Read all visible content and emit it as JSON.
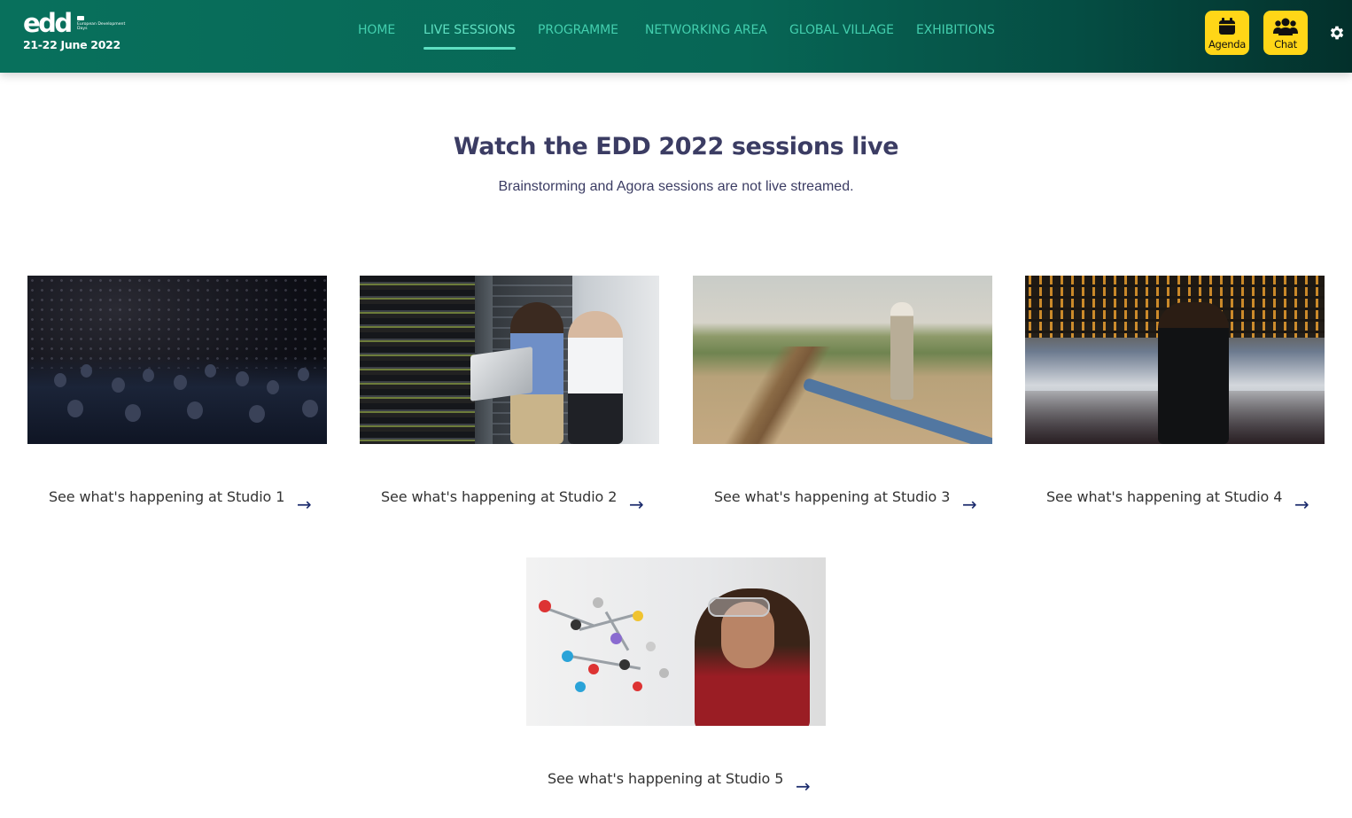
{
  "header": {
    "logo": {
      "wordmark": "edd",
      "subtitle": "European Development Days",
      "dates": "21-22 June 2022"
    },
    "nav": [
      {
        "label": "HOME",
        "active": false
      },
      {
        "label": "LIVE SESSIONS",
        "active": true
      },
      {
        "label": "PROGRAMME",
        "active": false
      },
      {
        "label": "NETWORKING AREA",
        "active": false
      },
      {
        "label": "GLOBAL VILLAGE",
        "active": false
      },
      {
        "label": "EXHIBITIONS",
        "active": false
      }
    ],
    "buttons": {
      "agenda": {
        "label": "Agenda",
        "icon": "calendar-icon"
      },
      "chat": {
        "label": "Chat",
        "icon": "users-icon"
      }
    },
    "settings_icon": "gear-icon",
    "colors": {
      "header_bg": "#08705c",
      "nav_text": "#43cfae",
      "button_bg": "#ffd617"
    }
  },
  "main": {
    "title": "Watch the EDD 2022 sessions live",
    "subtitle": "Brainstorming and Agora sessions are not live streamed.",
    "studios": [
      {
        "label": "See what's happening at Studio 1",
        "arrow": "→"
      },
      {
        "label": "See what's happening at Studio 2",
        "arrow": "→"
      },
      {
        "label": "See what's happening at Studio 3",
        "arrow": "→"
      },
      {
        "label": "See what's happening at Studio 4",
        "arrow": "→"
      },
      {
        "label": "See what's happening at Studio 5",
        "arrow": "→"
      }
    ],
    "colors": {
      "title": "#3b3c63",
      "arrow": "#1a2a6c"
    }
  }
}
